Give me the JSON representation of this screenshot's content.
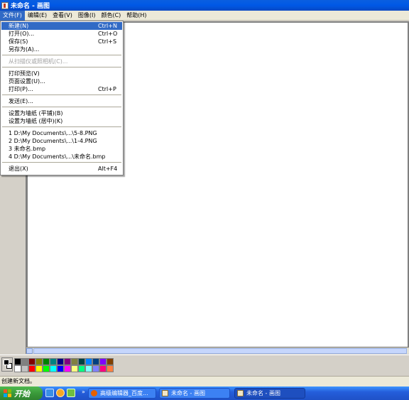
{
  "window": {
    "title": "未命名 - 画图"
  },
  "menubar": [
    {
      "label": "文件(F)"
    },
    {
      "label": "编辑(E)"
    },
    {
      "label": "查看(V)"
    },
    {
      "label": "图像(I)"
    },
    {
      "label": "颜色(C)"
    },
    {
      "label": "帮助(H)"
    }
  ],
  "file_menu": {
    "new": {
      "label": "新建(N)",
      "shortcut": "Ctrl+N"
    },
    "open": {
      "label": "打开(O)...",
      "shortcut": "Ctrl+O"
    },
    "save": {
      "label": "保存(S)",
      "shortcut": "Ctrl+S"
    },
    "save_as": {
      "label": "另存为(A)..."
    },
    "from_scanner": {
      "label": "从扫描仪或照相机(C)..."
    },
    "print_preview": {
      "label": "打印预览(V)"
    },
    "page_setup": {
      "label": "页面设置(U)..."
    },
    "print": {
      "label": "打印(P)...",
      "shortcut": "Ctrl+P"
    },
    "send": {
      "label": "发送(E)..."
    },
    "wallpaper_tile": {
      "label": "设置为墙纸 (平铺)(B)"
    },
    "wallpaper_center": {
      "label": "设置为墙纸 (居中)(K)"
    },
    "recent": [
      {
        "label": "1 D:\\My Documents\\...\\5-8.PNG"
      },
      {
        "label": "2 D:\\My Documents\\...\\1-4.PNG"
      },
      {
        "label": "3 未命名.bmp"
      },
      {
        "label": "4 D:\\My Documents\\...\\未命名.bmp"
      }
    ],
    "exit": {
      "label": "退出(X)",
      "shortcut": "Alt+F4"
    }
  },
  "palette": {
    "foreground": "#000000",
    "background": "#ffffff",
    "colors": [
      "#000000",
      "#808080",
      "#800000",
      "#808000",
      "#008000",
      "#008080",
      "#000080",
      "#800080",
      "#808040",
      "#004040",
      "#0080ff",
      "#004080",
      "#8000ff",
      "#804000",
      "#ffffff",
      "#c0c0c0",
      "#ff0000",
      "#ffff00",
      "#00ff00",
      "#00ffff",
      "#0000ff",
      "#ff00ff",
      "#ffff80",
      "#00ff80",
      "#80ffff",
      "#8080ff",
      "#ff0080",
      "#ff8040"
    ]
  },
  "statusbar": {
    "text": "创建新文档。"
  },
  "taskbar": {
    "start_label": "开始",
    "quick_launch": [
      "ie-icon",
      "media-icon",
      "app-icon"
    ],
    "tasks": [
      {
        "label": "高级编辑器_百度...",
        "icon": "firefox-icon"
      },
      {
        "label": "未命名 - 画图",
        "icon": "paint-icon"
      },
      {
        "label": "未命名 - 画图",
        "icon": "paint-icon"
      }
    ]
  }
}
